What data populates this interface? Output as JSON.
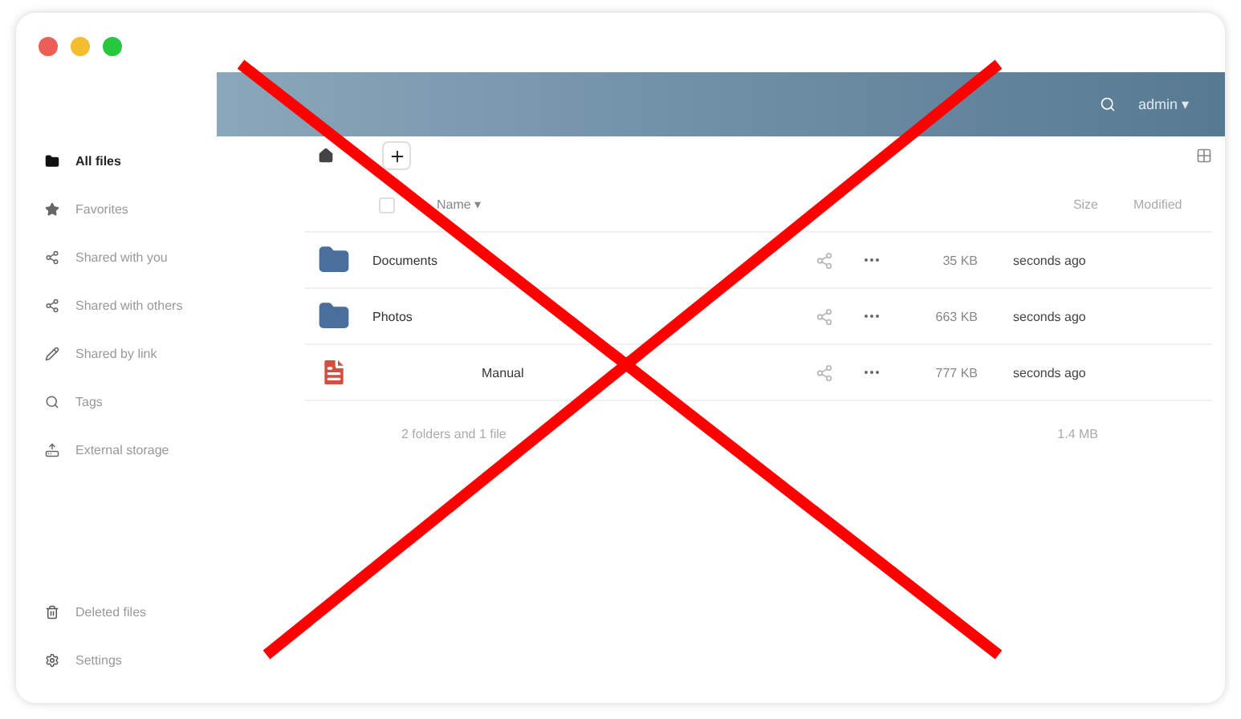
{
  "header": {
    "user_menu": "admin ▾"
  },
  "sidebar": {
    "items": [
      {
        "label": "All files",
        "selected": true
      },
      {
        "label": "Favorites",
        "selected": false
      },
      {
        "label": "Shared with you",
        "selected": false
      },
      {
        "label": "Shared with others",
        "selected": false
      },
      {
        "label": "Shared by link",
        "selected": false
      },
      {
        "label": "Tags",
        "selected": false
      },
      {
        "label": "External storage",
        "selected": false
      }
    ],
    "footer_items": [
      {
        "label": "Deleted files"
      },
      {
        "label": "Settings"
      }
    ]
  },
  "table": {
    "select_all_checked": false,
    "columns": [
      "Name ▾",
      "Size",
      "Modified"
    ],
    "rows": [
      {
        "kind": "folder",
        "name": "Documents",
        "size": "35 KB",
        "modified": "seconds ago"
      },
      {
        "kind": "folder",
        "name": "Photos",
        "size": "663 KB",
        "modified": "seconds ago"
      },
      {
        "kind": "pdf",
        "name": "Manual",
        "size": "777 KB",
        "modified": "seconds ago"
      }
    ],
    "summary": {
      "label": "2 folders and 1 file",
      "size": "1.4 MB"
    }
  }
}
